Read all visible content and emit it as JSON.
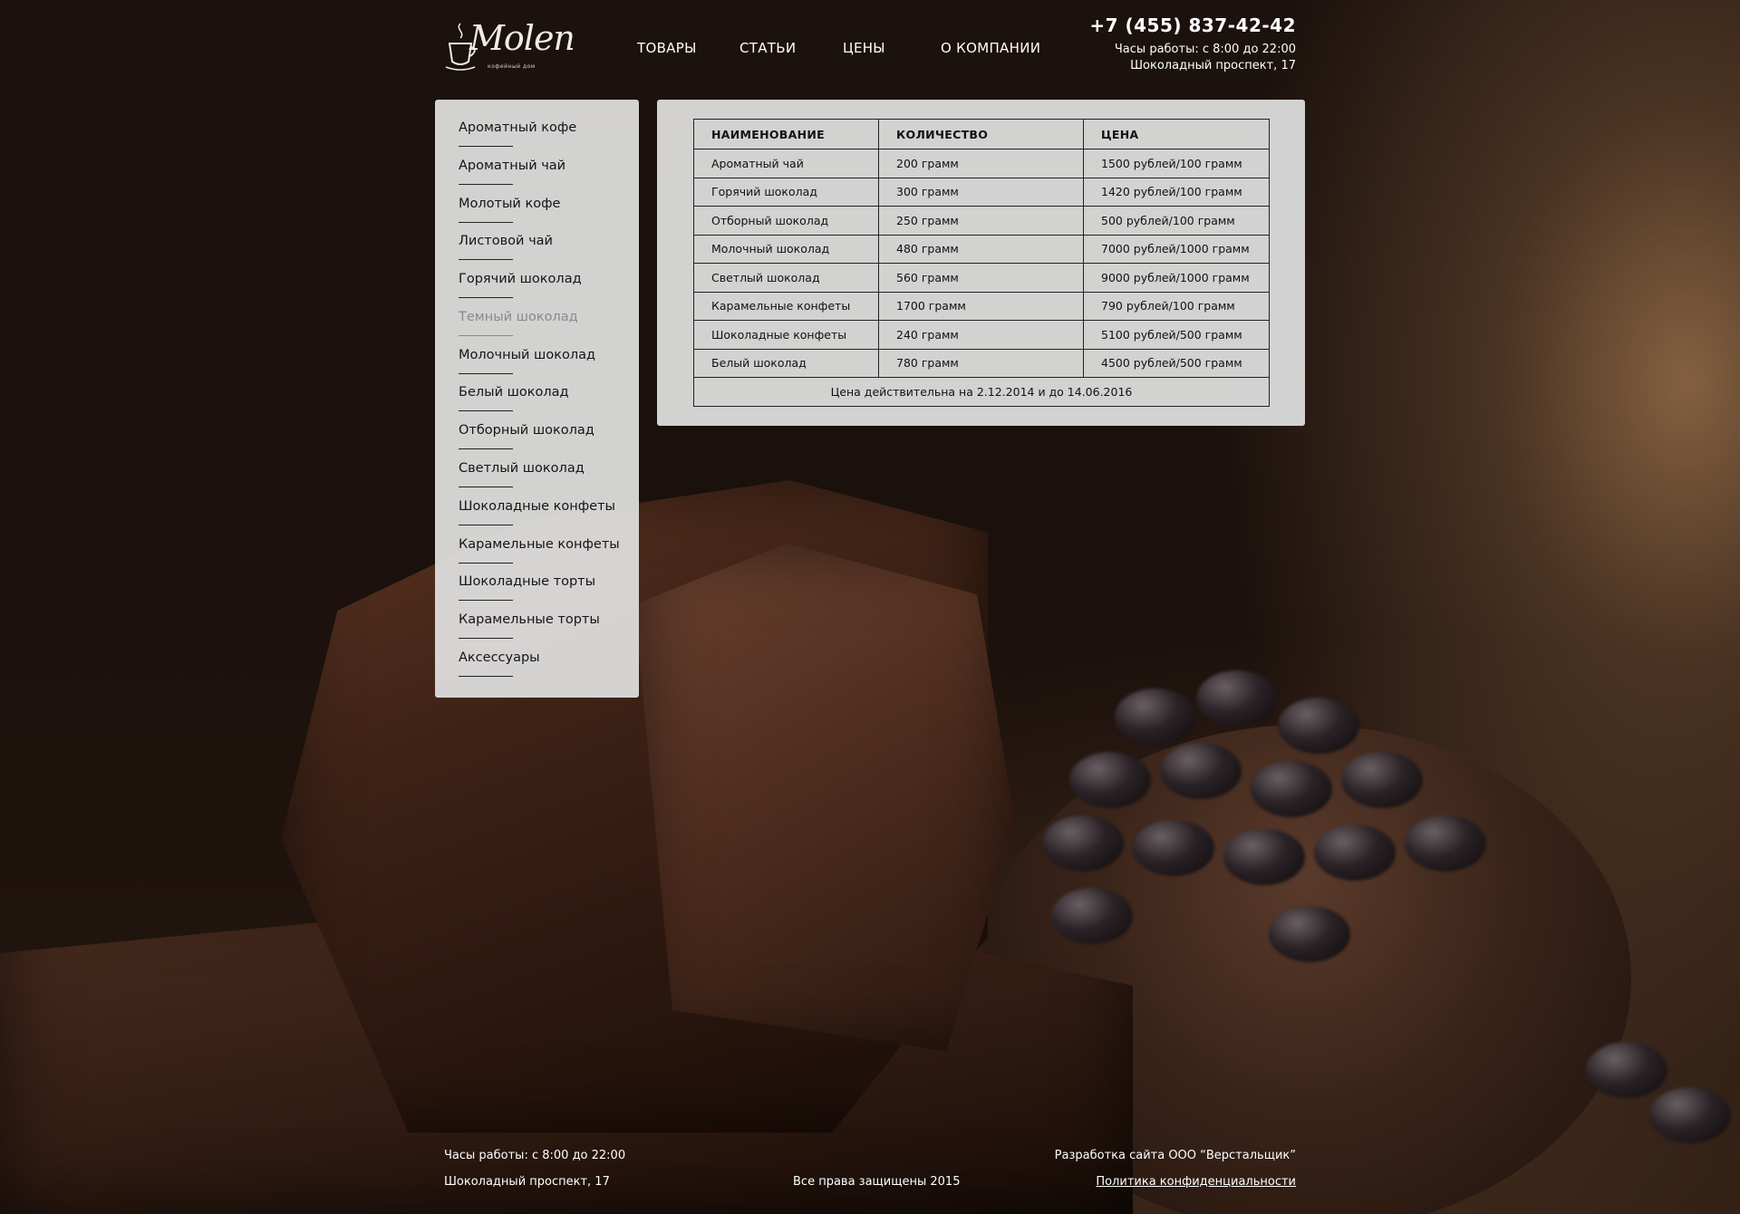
{
  "brand": {
    "logo_word": "Molen",
    "logo_sub": "кофейный дом"
  },
  "nav": [
    {
      "label": "ТОВАРЫ"
    },
    {
      "label": "СТАТЬИ"
    },
    {
      "label": "ЦЕНЫ"
    },
    {
      "label": "О КОМПАНИИ"
    }
  ],
  "contacts": {
    "phone": "+7 (455) 837-42-42",
    "hours": "Часы работы: с 8:00 до 22:00",
    "address": "Шоколадный проспект, 17"
  },
  "sidebar": {
    "items": [
      {
        "label": "Ароматный кофе"
      },
      {
        "label": "Ароматный чай"
      },
      {
        "label": "Молотый кофе"
      },
      {
        "label": "Листовой чай"
      },
      {
        "label": "Горячий шоколад"
      },
      {
        "label": "Темный шоколад",
        "active": true
      },
      {
        "label": "Молочный шоколад"
      },
      {
        "label": "Белый шоколад"
      },
      {
        "label": "Отборный шоколад"
      },
      {
        "label": "Светлый шоколад"
      },
      {
        "label": "Шоколадные конфеты"
      },
      {
        "label": "Карамельные конфеты"
      },
      {
        "label": "Шоколадные торты"
      },
      {
        "label": "Карамельные торты"
      },
      {
        "label": "Аксессуары"
      }
    ]
  },
  "price_table": {
    "headers": [
      "НАИМЕНОВАНИЕ",
      "КОЛИЧЕСТВО",
      "ЦЕНА"
    ],
    "rows": [
      [
        "Ароматный чай",
        "200 грамм",
        "1500 рублей/100 грамм"
      ],
      [
        "Горячий шоколад",
        "300 грамм",
        "1420 рублей/100 грамм"
      ],
      [
        "Отборный шоколад",
        "250 грамм",
        "500 рублей/100 грамм"
      ],
      [
        "Молочный шоколад",
        "480 грамм",
        "7000 рублей/1000 грамм"
      ],
      [
        "Светлый шоколад",
        "560 грамм",
        "9000 рублей/1000 грамм"
      ],
      [
        "Карамельные конфеты",
        "1700 грамм",
        "790 рублей/100 грамм"
      ],
      [
        "Шоколадные конфеты",
        "240 грамм",
        "5100 рублей/500 грамм"
      ],
      [
        "Белый шоколад",
        "780 грамм",
        "4500 рублей/500 грамм"
      ]
    ],
    "note": "Цена действительна на 2.12.2014 и до 14.06.2016"
  },
  "footer": {
    "hours": "Часы работы: с 8:00 до 22:00",
    "address": "Шоколадный проспект, 17",
    "copyright": "Все права защищены 2015",
    "developer": "Разработка сайта ООО “Верстальщик”",
    "privacy_link": "Политика конфиденциальности"
  }
}
